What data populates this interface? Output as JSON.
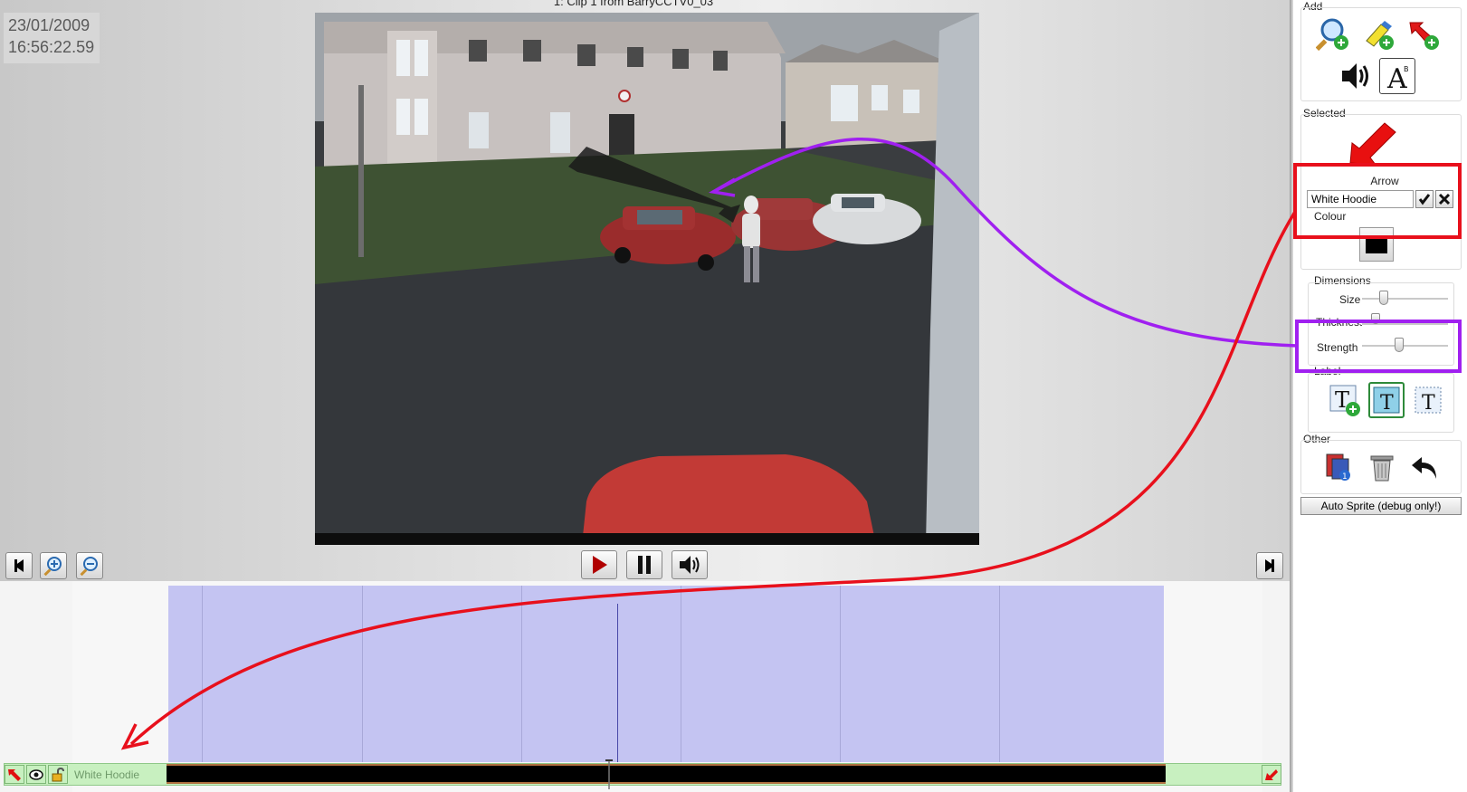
{
  "viewer": {
    "timestamp_date": "23/01/2009",
    "timestamp_time": "16:56:22.59",
    "clip_title": "1: Clip 1 from BarryCCTV0_03"
  },
  "sidebar": {
    "add_label": "Add",
    "selected_label": "Selected",
    "arrow_title": "Arrow",
    "name_value": "White Hoodie",
    "colour_label": "Colour",
    "dimensions_label": "Dimensions",
    "size_label": "Size",
    "thickness_label": "Thickness",
    "strength_label": "Strength",
    "label_label": "Label",
    "other_label": "Other",
    "auto_sprite_label": "Auto Sprite (debug only!)",
    "size_level": 0.22,
    "thickness_level": 0.12,
    "strength_level": 0.42
  },
  "timeline": {
    "track_label": "White Hoodie"
  },
  "colors": {
    "highlight_red": "#e8101c",
    "highlight_purple": "#a020f0",
    "timeline_range": "#c4c4f2",
    "track_green": "#c8f0c0"
  }
}
